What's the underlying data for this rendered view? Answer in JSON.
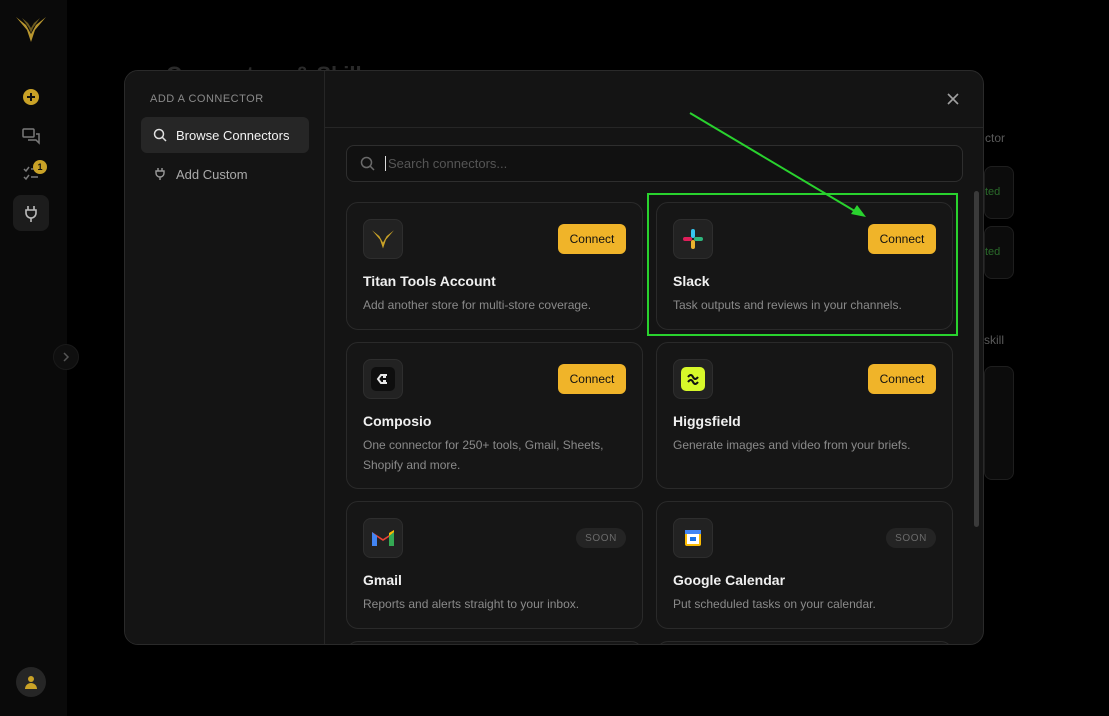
{
  "background": {
    "title": "Connectors & Skills",
    "frag_connector": "ctor",
    "frag_skill": "skill",
    "frag_status_1": "ted",
    "frag_status_2": "ted"
  },
  "rail": {
    "tasks_badge": "1"
  },
  "modal": {
    "side_heading": "ADD A CONNECTOR",
    "side_items": [
      {
        "label": "Browse Connectors"
      },
      {
        "label": "Add Custom"
      }
    ],
    "search_placeholder": "Search connectors...",
    "search_value": "",
    "connectors": [
      {
        "name": "Titan Tools Account",
        "desc": "Add another store for multi-store coverage.",
        "action": "Connect"
      },
      {
        "name": "Slack",
        "desc": "Task outputs and reviews in your channels.",
        "action": "Connect"
      },
      {
        "name": "Composio",
        "desc": "One connector for 250+ tools, Gmail, Sheets, Shopify and more.",
        "action": "Connect"
      },
      {
        "name": "Higgsfield",
        "desc": "Generate images and video from your briefs.",
        "action": "Connect"
      },
      {
        "name": "Gmail",
        "desc": "Reports and alerts straight to your inbox.",
        "status": "SOON"
      },
      {
        "name": "Google Calendar",
        "desc": "Put scheduled tasks on your calendar.",
        "status": "SOON"
      }
    ]
  },
  "colors": {
    "accent": "#f0b429",
    "annotation": "#29d22e",
    "background": "#000000",
    "modal": "#141414"
  },
  "icons": [
    "titan-wings-icon",
    "plus-circle-icon",
    "chat-icon",
    "tasks-icon",
    "plug-icon",
    "user-icon",
    "search-icon",
    "close-icon",
    "slack-icon",
    "composio-icon",
    "higgsfield-icon",
    "gmail-icon",
    "google-calendar-icon"
  ]
}
